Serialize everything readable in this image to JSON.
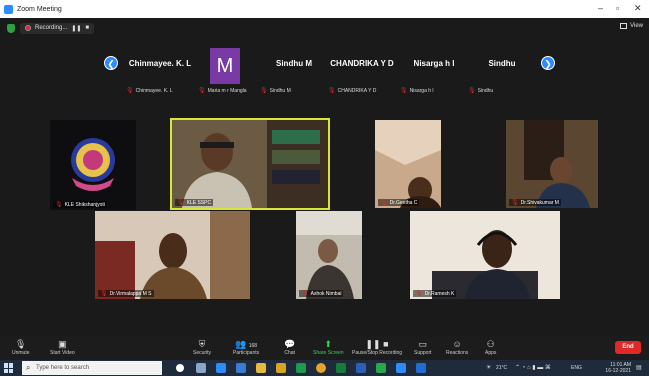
{
  "window": {
    "title": "Zoom Meeting"
  },
  "top": {
    "recording_label": "Recording...",
    "view_label": "View"
  },
  "thumbnails": [
    {
      "name": "Chinmayee. K. L",
      "label": "Chinmayee. K. L"
    },
    {
      "name": "M",
      "label": "Maria m r Mangla",
      "avatar": true
    },
    {
      "name": "Sindhu M",
      "label": "Sindhu M"
    },
    {
      "name": "CHANDRIKA Y D",
      "label": "CHANDRIKA Y D"
    },
    {
      "name": "Nisarga h l",
      "label": "Nisarga h l"
    },
    {
      "name": "Sindhu",
      "label": "Sindhu"
    }
  ],
  "tiles": [
    {
      "label": "KLE Shikshanjyoti"
    },
    {
      "label": "KLE SSPC"
    },
    {
      "label": "Dr.Geetha C"
    },
    {
      "label": "Dr.Shivakumar M"
    },
    {
      "label": "Dr.Virmalappa M S"
    },
    {
      "label": "Ashok Nimbal"
    },
    {
      "label": "Dr.Ramesh K"
    }
  ],
  "toolbar": {
    "unmute": "Unmute",
    "start_video": "Start Video",
    "security": "Security",
    "participants": "Participants",
    "participants_count": "168",
    "chat": "Chat",
    "share_screen": "Share Screen",
    "pause_recording": "Pause/Stop Recording",
    "support": "Support",
    "reactions": "Reactions",
    "apps": "Apps",
    "end": "End"
  },
  "taskbar": {
    "search_placeholder": "Type here to search",
    "temperature": "21°C",
    "time": "11:01 AM",
    "date": "16-12-2021",
    "lang": "ENG"
  }
}
